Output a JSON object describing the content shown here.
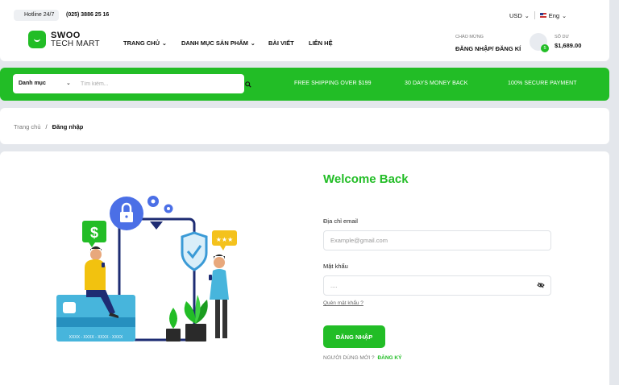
{
  "topbar": {
    "hotline_label": "Hotline 24/7",
    "phone": "(025) 3886 25 16",
    "currency": "USD",
    "language": "Eng"
  },
  "brand": {
    "line1": "SWOO",
    "line2": "TECH MART"
  },
  "nav": {
    "items": [
      {
        "label": "TRANG CHỦ",
        "has_dropdown": true
      },
      {
        "label": "DANH MỤC SẢN PHẨM",
        "has_dropdown": true
      },
      {
        "label": "BÀI VIẾT",
        "has_dropdown": false
      },
      {
        "label": "LIÊN HỆ",
        "has_dropdown": false
      }
    ]
  },
  "account": {
    "greeting": "CHÀO MỪNG",
    "login_link": "ĐĂNG NHẬP/ ĐĂNG KÍ"
  },
  "cart": {
    "count": "5",
    "balance_label": "SỐ DƯ",
    "balance": "$1,689.00"
  },
  "search": {
    "category": "Danh mục",
    "placeholder": "Tìm kiếm..."
  },
  "promos": [
    "FREE SHIPPING OVER $199",
    "30 DAYS MONEY BACK",
    "100% SECURE PAYMENT"
  ],
  "breadcrumb": {
    "home": "Trang chủ",
    "separator": "/",
    "current": "Đăng nhập"
  },
  "login": {
    "title": "Welcome Back",
    "email_label": "Địa chỉ email",
    "email_placeholder": "Example@gmail.com",
    "password_label": "Mật khẩu",
    "password_value": "....",
    "forgot": "Quên mật khẩu ?",
    "submit": "ĐĂNG NHẬP",
    "new_user": "NGƯỜI DÙNG MỚI ?",
    "register": "ĐĂNG KÝ"
  },
  "illustration": {
    "card_number": "XXXX - XXXX - XXXX - XXXX"
  },
  "colors": {
    "brand_green": "#22bd26",
    "page_bg": "#e4e7ec"
  }
}
